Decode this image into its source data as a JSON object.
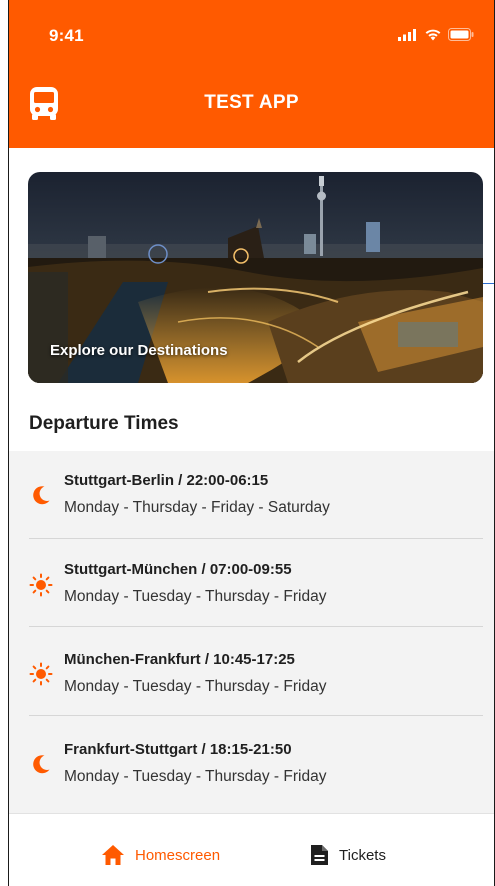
{
  "status_bar": {
    "time": "9:41"
  },
  "app_bar": {
    "title": "TEST APP",
    "icon": "bus-icon"
  },
  "hero": {
    "caption": "Explore our Destinations"
  },
  "departures": {
    "title": "Departure Times",
    "items": [
      {
        "icon": "moon-icon",
        "route": "Stuttgart-Berlin /  22:00-06:15",
        "days": "Monday - Thursday - Friday - Saturday"
      },
      {
        "icon": "sun-icon",
        "route": "Stuttgart-München /  07:00-09:55",
        "days": "Monday - Tuesday - Thursday - Friday"
      },
      {
        "icon": "sun-icon",
        "route": "München-Frankfurt /  10:45-17:25",
        "days": "Monday - Tuesday - Thursday - Friday"
      },
      {
        "icon": "moon-icon",
        "route": "Frankfurt-Stuttgart /  18:15-21:50",
        "days": "Monday - Tuesday - Thursday - Friday"
      }
    ]
  },
  "bottom_nav": {
    "items": [
      {
        "label": "Homescreen",
        "icon": "home-icon",
        "active": true
      },
      {
        "label": "Tickets",
        "icon": "document-icon",
        "active": false
      }
    ]
  },
  "colors": {
    "accent": "#ff5a00",
    "list_background": "#f3f3f3",
    "text": "#1f1f1f"
  }
}
